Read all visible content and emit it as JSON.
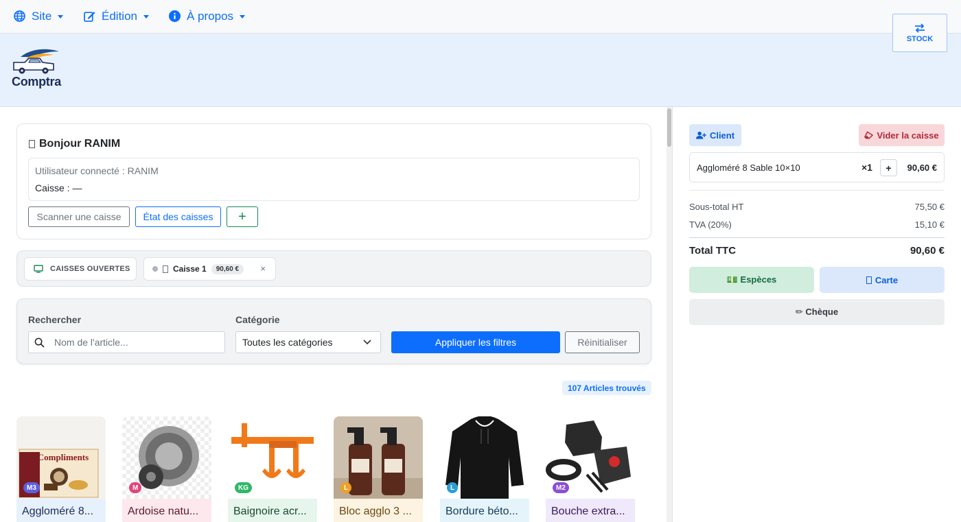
{
  "nav": {
    "site": "Site",
    "edition": "Édition",
    "apropos": "À propos",
    "stock": "STOCK"
  },
  "brand": {
    "name": "Comptra"
  },
  "greeting": {
    "title": "Bonjour RANIM",
    "user_line": "Utilisateur connecté : RANIM",
    "caisse_line": "Caisse : —",
    "scan_label": "Scanner une caisse",
    "etat_label": "État des caisses",
    "plus_label": "+"
  },
  "tabs": {
    "open_label": "CAISSES OUVERTES",
    "caisse_name": "Caisse 1",
    "caisse_amount": "90,60 €",
    "close_label": "×"
  },
  "filters": {
    "search_label": "Rechercher",
    "search_placeholder": "Nom de l'article...",
    "category_label": "Catégorie",
    "category_value": "Toutes les catégories",
    "apply_label": "Appliquer les filtres",
    "reset_label": "Réinitialiser"
  },
  "results": {
    "count": "107 Articles trouvés"
  },
  "products": [
    {
      "name": "Aggloméré 8...",
      "badge": "M3",
      "badge_color": "#5b5fe0",
      "cap_bg": "#e7f1fd",
      "cap_color": "#1a2a5a"
    },
    {
      "name": "Ardoise natu...",
      "badge": "M",
      "badge_color": "#e0457b",
      "cap_bg": "#fde8ee",
      "cap_color": "#5a1a2a"
    },
    {
      "name": "Baignoire acr...",
      "badge": "KG",
      "badge_color": "#2fb86a",
      "cap_bg": "#e6f6ec",
      "cap_color": "#1a4a2a"
    },
    {
      "name": "Bloc agglo 3 ...",
      "badge": "L",
      "badge_color": "#f0a020",
      "cap_bg": "#fdf3e2",
      "cap_color": "#6a4a10"
    },
    {
      "name": "Bordure béto...",
      "badge": "L",
      "badge_color": "#2a9fd6",
      "cap_bg": "#e5f4fb",
      "cap_color": "#123a5a"
    },
    {
      "name": "Bouche extra...",
      "badge": "M2",
      "badge_color": "#8a4fd6",
      "cap_bg": "#f0e8fb",
      "cap_color": "#3a1a5a"
    }
  ],
  "cart": {
    "client_label": "Client",
    "vider_label": "Vider la caisse",
    "item_name": "Aggloméré 8 Sable 10×10",
    "item_qty": "×1",
    "item_plus": "+",
    "item_price": "90,60 €",
    "subtotal_label": "Sous-total HT",
    "subtotal_value": "75,50 €",
    "tva_label": "TVA (20%)",
    "tva_value": "15,10 €",
    "total_label": "Total TTC",
    "total_value": "90,60 €",
    "pay_especes": "💵 Espèces",
    "pay_carte": "Carte",
    "pay_cheque": "✏ Chèque"
  },
  "colors": {
    "primary": "#0d6efd",
    "success": "#198754",
    "danger": "#b02a37"
  }
}
